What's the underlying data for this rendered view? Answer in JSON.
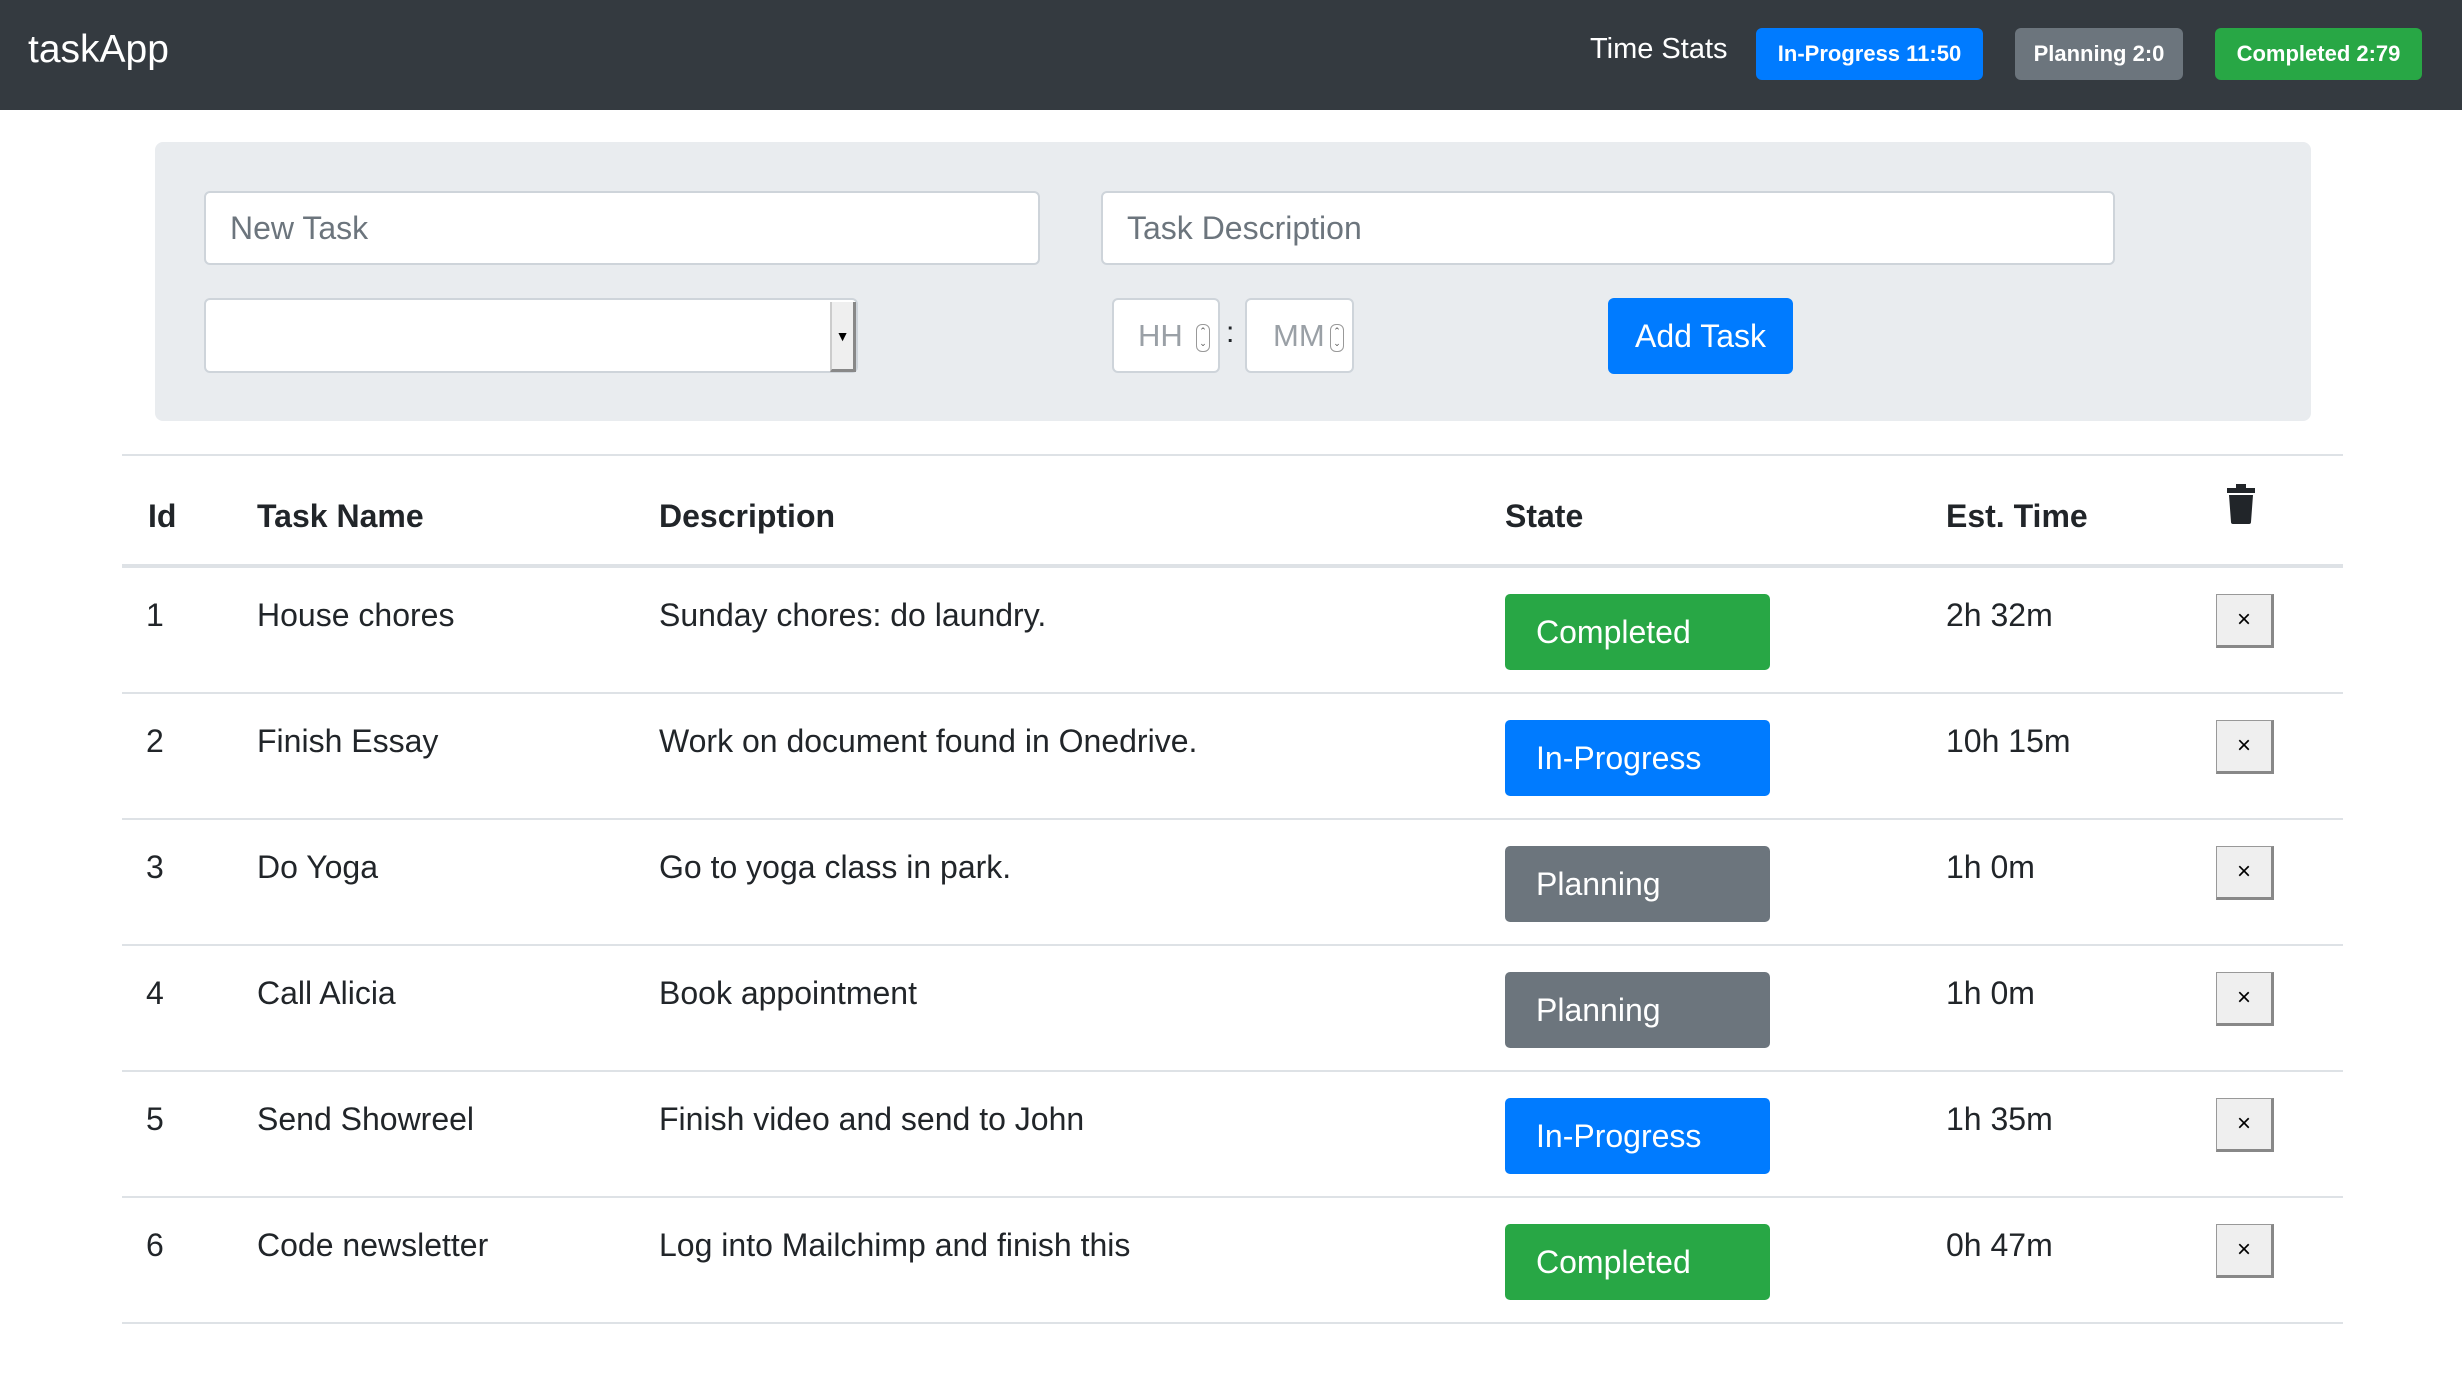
{
  "navbar": {
    "brand": "taskApp",
    "stats_label": "Time Stats",
    "badges": [
      {
        "label": "In-Progress 11:50",
        "color": "#007bff"
      },
      {
        "label": "Planning 2:0",
        "color": "#6c757d"
      },
      {
        "label": "Completed 2:79",
        "color": "#28a745"
      }
    ]
  },
  "form": {
    "task_name_placeholder": "New Task",
    "task_description_placeholder": "Task Description",
    "state_select_value": "",
    "hours_placeholder": "HH",
    "minutes_placeholder": "MM",
    "time_separator": ":",
    "add_button": "Add Task"
  },
  "table": {
    "headers": [
      "Id",
      "Task Name",
      "Description",
      "State",
      "Est. Time"
    ],
    "delete_all_icon": "trash-icon",
    "delete_row_label": "×",
    "state_colors": {
      "Completed": "#28a745",
      "In-Progress": "#007bff",
      "Planning": "#6c757d"
    },
    "rows": [
      {
        "id": "1",
        "name": "House chores",
        "description": "Sunday chores: do laundry.",
        "state": "Completed",
        "time": "2h 32m"
      },
      {
        "id": "2",
        "name": "Finish Essay",
        "description": "Work on document found in Onedrive.",
        "state": "In-Progress",
        "time": "10h 15m"
      },
      {
        "id": "3",
        "name": "Do Yoga",
        "description": "Go to yoga class in park.",
        "state": "Planning",
        "time": "1h 0m"
      },
      {
        "id": "4",
        "name": "Call Alicia",
        "description": "Book appointment",
        "state": "Planning",
        "time": "1h 0m"
      },
      {
        "id": "5",
        "name": "Send Showreel",
        "description": "Finish video and send to John",
        "state": "In-Progress",
        "time": "1h 35m"
      },
      {
        "id": "6",
        "name": "Code newsletter",
        "description": "Log into Mailchimp and finish this",
        "state": "Completed",
        "time": "0h 47m"
      }
    ]
  }
}
